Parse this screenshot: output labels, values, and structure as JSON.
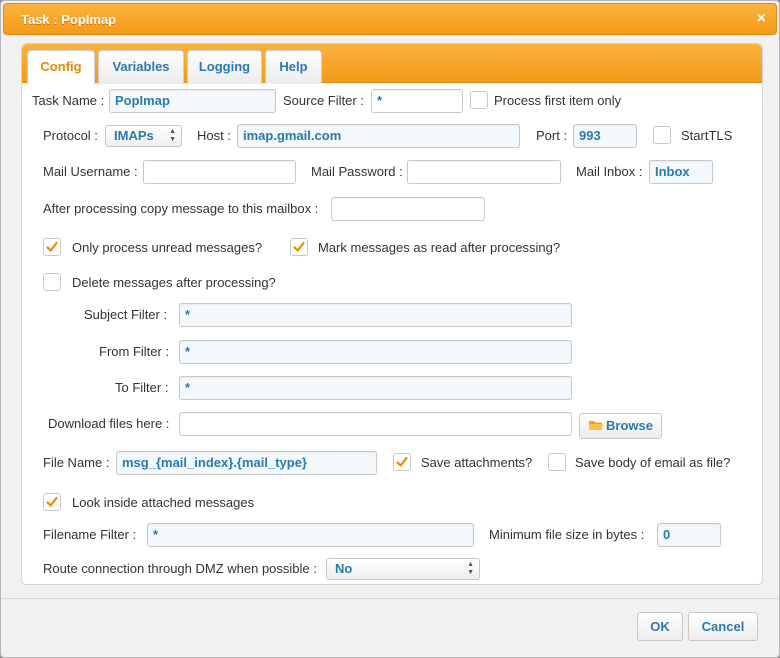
{
  "dialog": {
    "title": "Task : PopImap",
    "close_glyph": "×"
  },
  "tabs": [
    {
      "label": "Config",
      "active": true
    },
    {
      "label": "Variables",
      "active": false
    },
    {
      "label": "Logging",
      "active": false
    },
    {
      "label": "Help",
      "active": false
    }
  ],
  "form": {
    "task_name": {
      "label": "Task Name :",
      "value": "PopImap"
    },
    "source_filter": {
      "label": "Source Filter :",
      "value": "*"
    },
    "process_first": {
      "label": "Process first item only",
      "checked": false
    },
    "protocol": {
      "label": "Protocol :",
      "value": "IMAPs"
    },
    "host": {
      "label": "Host :",
      "value": "imap.gmail.com"
    },
    "port": {
      "label": "Port :",
      "value": "993"
    },
    "starttls": {
      "label": "StartTLS",
      "checked": false
    },
    "mail_username": {
      "label": "Mail Username :",
      "value": ""
    },
    "mail_password": {
      "label": "Mail Password :",
      "value": ""
    },
    "mail_inbox": {
      "label": "Mail Inbox :",
      "value": "Inbox"
    },
    "copy_mailbox": {
      "label": "After processing copy message to this mailbox :",
      "value": ""
    },
    "only_unread": {
      "label": "Only process unread messages?",
      "checked": true
    },
    "mark_read": {
      "label": "Mark messages as read after processing?",
      "checked": true
    },
    "delete_after": {
      "label": "Delete messages after processing?",
      "checked": false
    },
    "subject_filter": {
      "label": "Subject Filter :",
      "value": "*"
    },
    "from_filter": {
      "label": "From Filter :",
      "value": "*"
    },
    "to_filter": {
      "label": "To Filter :",
      "value": "*"
    },
    "download_dir": {
      "label": "Download files here :",
      "value": ""
    },
    "browse_label": "Browse",
    "file_name": {
      "label": "File Name :",
      "value": "msg_{mail_index}.{mail_type}"
    },
    "save_attachments": {
      "label": "Save attachments?",
      "checked": true
    },
    "save_body": {
      "label": "Save body of email as file?",
      "checked": false
    },
    "look_inside": {
      "label": "Look inside attached messages",
      "checked": true
    },
    "filename_filter": {
      "label": "Filename Filter :",
      "value": "*"
    },
    "min_size": {
      "label": "Minimum file size in bytes :",
      "value": "0"
    },
    "dmz": {
      "label": "Route connection through DMZ when possible :",
      "value": "No"
    }
  },
  "buttons": {
    "ok": "OK",
    "cancel": "Cancel"
  },
  "colors": {
    "accent_orange": "#f49a18",
    "link_blue": "#2a7ab0",
    "check_orange": "#f08a00"
  }
}
